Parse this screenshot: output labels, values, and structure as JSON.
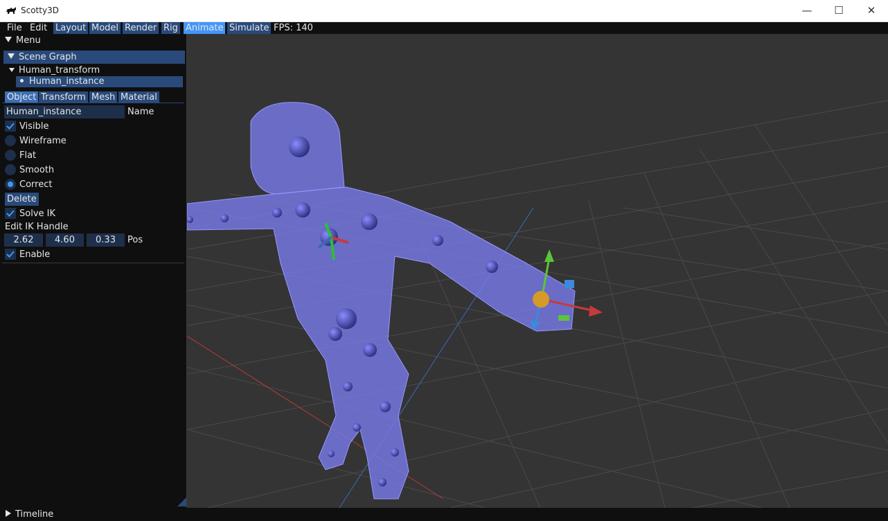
{
  "window": {
    "title": "Scotty3D",
    "minimize": "—",
    "maximize": "☐",
    "close": "✕"
  },
  "menubar": {
    "items": [
      "File",
      "Edit"
    ],
    "modes": [
      "Layout",
      "Model",
      "Render",
      "Rig",
      "Animate",
      "Simulate"
    ],
    "active_mode": "Animate",
    "fps": "FPS: 140"
  },
  "panel": {
    "menu_title": "Menu",
    "scene_graph_title": "Scene Graph",
    "tree": {
      "parent": "Human_transform",
      "child": "Human_instance"
    },
    "tabs": [
      "Object",
      "Transform",
      "Mesh",
      "Material"
    ],
    "active_tab": "Object",
    "name_value": "Human_instance",
    "name_label": "Name",
    "visible_label": "Visible",
    "render_modes": [
      "Wireframe",
      "Flat",
      "Smooth",
      "Correct"
    ],
    "render_mode_selected": "Correct",
    "delete_label": "Delete",
    "solve_ik_label": "Solve IK",
    "edit_ik_label": "Edit IK Handle",
    "ik_pos": [
      "2.62",
      "4.60",
      "0.33"
    ],
    "pos_label": "Pos",
    "enable_label": "Enable"
  },
  "timeline": {
    "label": "Timeline"
  },
  "colors": {
    "panel_bg": "#0f0f0f",
    "header_blue": "#294a7a",
    "active_blue": "#4296fa",
    "viewport_bg": "#343434",
    "mesh_color": "#7a7cf0"
  }
}
